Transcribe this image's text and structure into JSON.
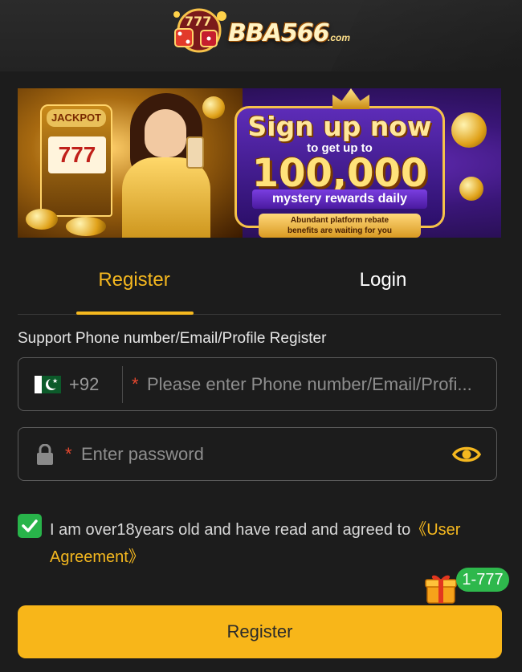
{
  "header": {
    "logo_text": "BBA566",
    "logo_suffix": ".com"
  },
  "banner": {
    "slot_label": "JACKPOT",
    "slot_reels": "777",
    "headline": "Sign up now",
    "subline": "to get up to",
    "amount": "100,000",
    "rewards": "mystery rewards daily",
    "rebate_line1": "Abundant platform rebate",
    "rebate_line2": "benefits are waiting for you"
  },
  "tabs": {
    "register": "Register",
    "login": "Login"
  },
  "form": {
    "hint": "Support Phone number/Email/Profile Register",
    "country_code": "+92",
    "phone_placeholder": "Please enter Phone number/Email/Profi...",
    "password_placeholder": "Enter password",
    "required_mark": "*"
  },
  "agreement": {
    "text": "I am over18years old and have read and agreed to",
    "link": "《User Agreement》",
    "checked": true
  },
  "gift": {
    "badge": "1-777"
  },
  "actions": {
    "register_button": "Register"
  },
  "colors": {
    "accent": "#f5b81f",
    "background": "#1c1c1c",
    "success": "#28b44a",
    "required": "#e5482f"
  },
  "icons": [
    "pakistan-flag-icon",
    "lock-icon",
    "eye-icon",
    "checkmark-icon",
    "gift-icon"
  ]
}
